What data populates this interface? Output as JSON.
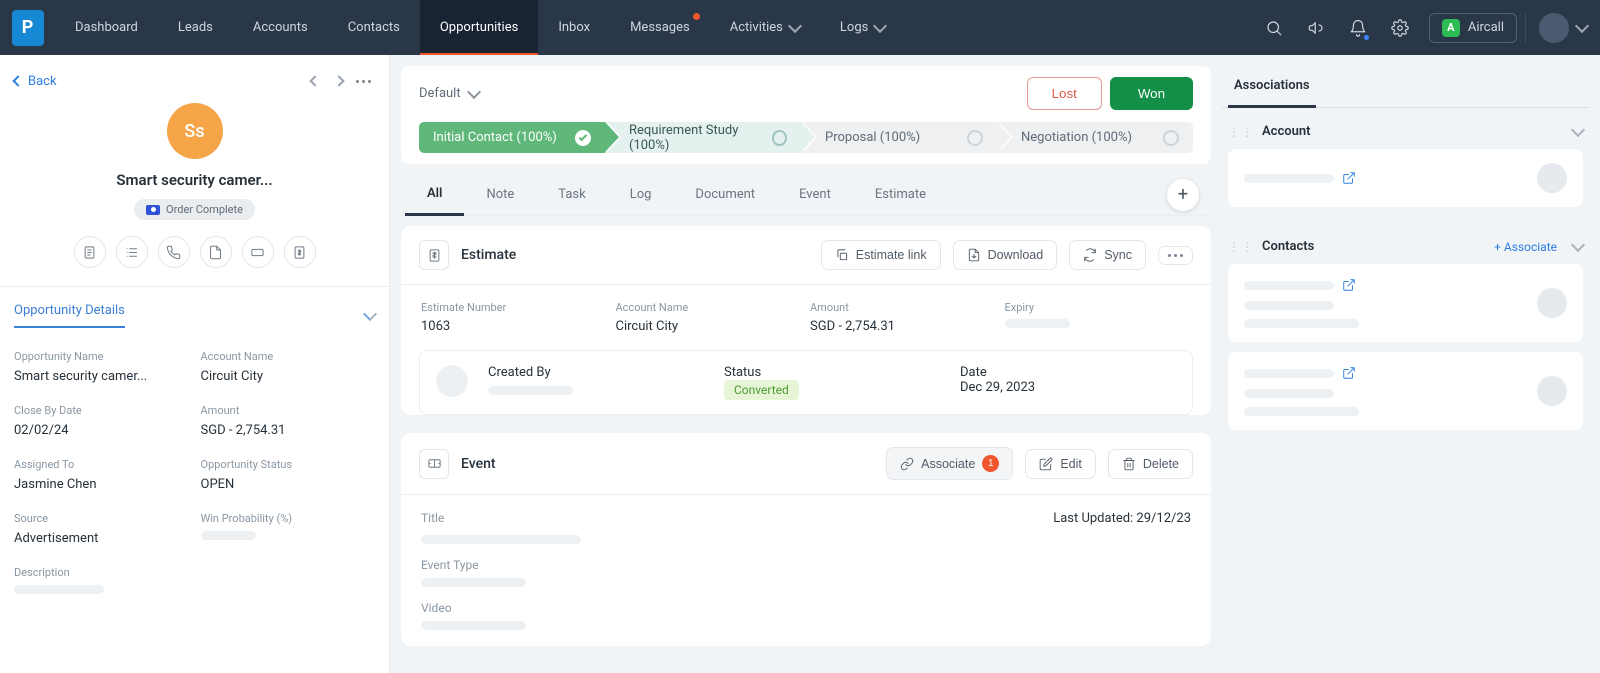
{
  "nav": {
    "items": [
      "Dashboard",
      "Leads",
      "Accounts",
      "Contacts",
      "Opportunities",
      "Inbox",
      "Messages",
      "Activities",
      "Logs"
    ],
    "active": "Opportunities",
    "aircall": "Aircall"
  },
  "left": {
    "back": "Back",
    "initials": "Ss",
    "title": "Smart security camer...",
    "status": "Order Complete",
    "section_title": "Opportunity Details",
    "fields": {
      "opp_name": {
        "label": "Opportunity Name",
        "value": "Smart security camer..."
      },
      "account_name": {
        "label": "Account Name",
        "value": "Circuit City"
      },
      "close_by": {
        "label": "Close By Date",
        "value": "02/02/24"
      },
      "amount": {
        "label": "Amount",
        "value": "SGD - 2,754.31"
      },
      "assigned_to": {
        "label": "Assigned To",
        "value": "Jasmine Chen"
      },
      "opp_status": {
        "label": "Opportunity Status",
        "value": "OPEN"
      },
      "source": {
        "label": "Source",
        "value": "Advertisement"
      },
      "win_prob": {
        "label": "Win Probability (%)"
      },
      "description": {
        "label": "Description"
      }
    }
  },
  "center": {
    "view": "Default",
    "lost": "Lost",
    "won": "Won",
    "stages": [
      {
        "label": "Initial Contact (100%)",
        "state": "done"
      },
      {
        "label": "Requirement Study (100%)",
        "state": "cur"
      },
      {
        "label": "Proposal (100%)",
        "state": ""
      },
      {
        "label": "Negotiation (100%)",
        "state": ""
      }
    ],
    "tabs": [
      "All",
      "Note",
      "Task",
      "Log",
      "Document",
      "Event",
      "Estimate"
    ],
    "active_tab": "All",
    "estimate_card": {
      "title": "Estimate",
      "btn_link": "Estimate link",
      "btn_dl": "Download",
      "btn_sync": "Sync",
      "num_label": "Estimate Number",
      "num": "1063",
      "acct_label": "Account Name",
      "acct": "Circuit City",
      "amt_label": "Amount",
      "amt": "SGD - 2,754.31",
      "exp_label": "Expiry",
      "created_label": "Created By",
      "status_label": "Status",
      "status": "Converted",
      "date_label": "Date",
      "date": "Dec 29, 2023"
    },
    "event_card": {
      "title": "Event",
      "associate": "Associate",
      "associate_count": "1",
      "edit": "Edit",
      "delete": "Delete",
      "title_label": "Title",
      "last_updated": "Last Updated: 29/12/23",
      "type_label": "Event Type",
      "video_label": "Video"
    }
  },
  "assoc": {
    "title": "Associations",
    "account": "Account",
    "contacts": "Contacts",
    "add": "+ Associate"
  }
}
